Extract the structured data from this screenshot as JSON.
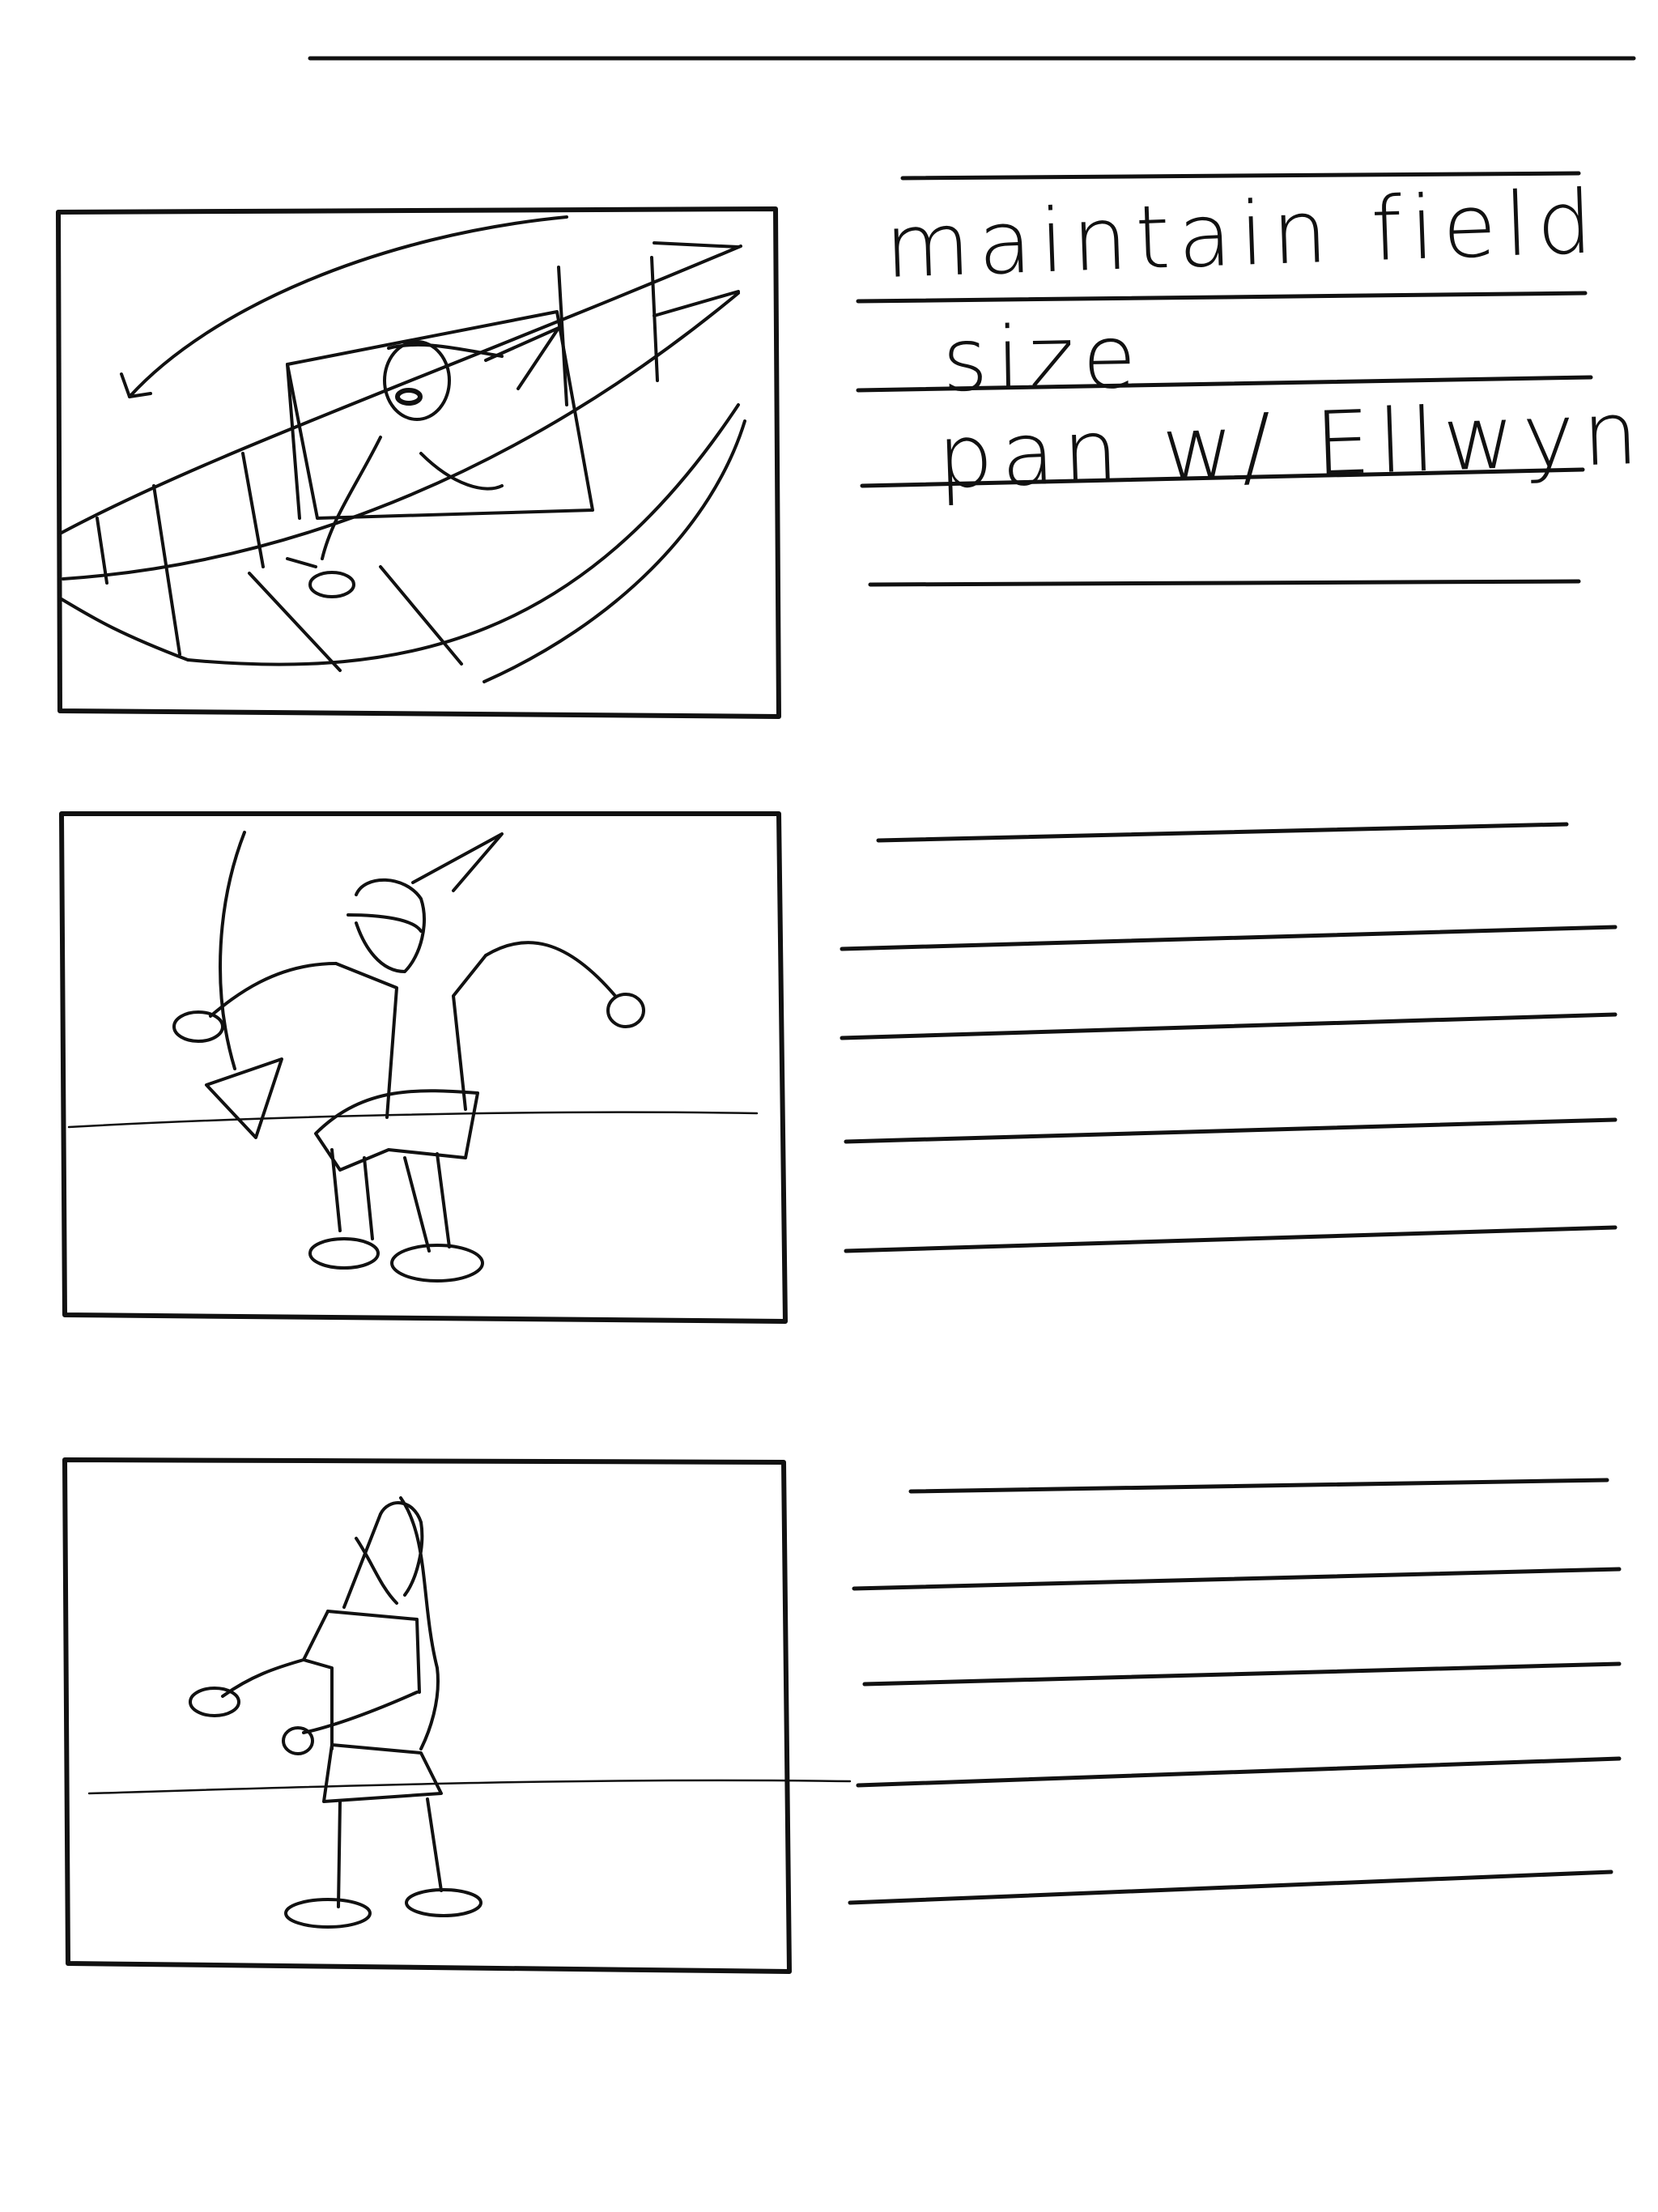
{
  "storyboard": {
    "panels": [
      {
        "notes": [
          "maintain field",
          "size",
          "pan w/ Ellwyn"
        ]
      },
      {
        "notes": []
      },
      {
        "notes": []
      }
    ]
  },
  "colors": {
    "paper": "#ffffff",
    "ink": "#111111"
  }
}
